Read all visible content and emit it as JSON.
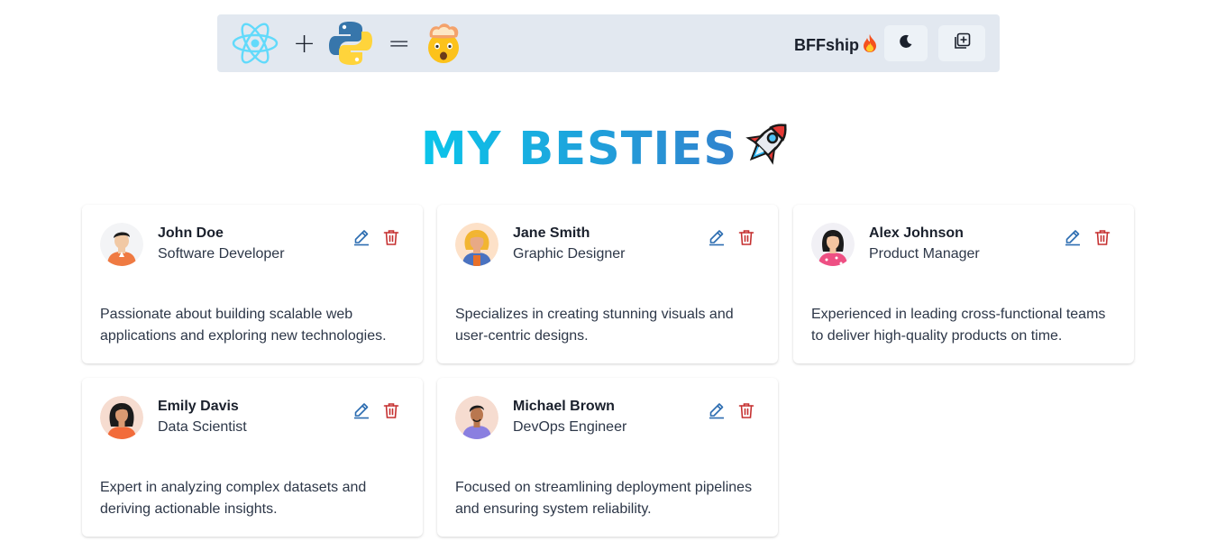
{
  "navbar": {
    "logos": [
      "react-logo",
      "python-logo",
      "exploding-head-emoji"
    ],
    "plus": "+",
    "equals": "=",
    "brand": "BFFship",
    "brand_emoji": "🔥",
    "theme_toggle_icon": "moon-icon",
    "add_friend_icon": "add-square-icon"
  },
  "heading": {
    "text": "MY BESTIES",
    "icon": "rocket-icon",
    "gradient_colors": [
      "#0bc5ea",
      "#3182ce"
    ]
  },
  "colors": {
    "navbar_bg": "#e2e8f0",
    "edit_icon": "#2b6cb0",
    "delete_icon": "#c53030"
  },
  "friends": [
    {
      "name": "John Doe",
      "role": "Software Developer",
      "description": "Passionate about building scalable web applications and exploring new technologies.",
      "avatar": "boy-avatar"
    },
    {
      "name": "Jane Smith",
      "role": "Graphic Designer",
      "description": "Specializes in creating stunning visuals and user-centric designs.",
      "avatar": "girl-avatar"
    },
    {
      "name": "Alex Johnson",
      "role": "Product Manager",
      "description": "Experienced in leading cross-functional teams to deliver high-quality products on time.",
      "avatar": "girl-avatar"
    },
    {
      "name": "Emily Davis",
      "role": "Data Scientist",
      "description": "Expert in analyzing complex datasets and deriving actionable insights.",
      "avatar": "girl-avatar"
    },
    {
      "name": "Michael Brown",
      "role": "DevOps Engineer",
      "description": "Focused on streamlining deployment pipelines and ensuring system reliability.",
      "avatar": "boy-avatar"
    }
  ]
}
